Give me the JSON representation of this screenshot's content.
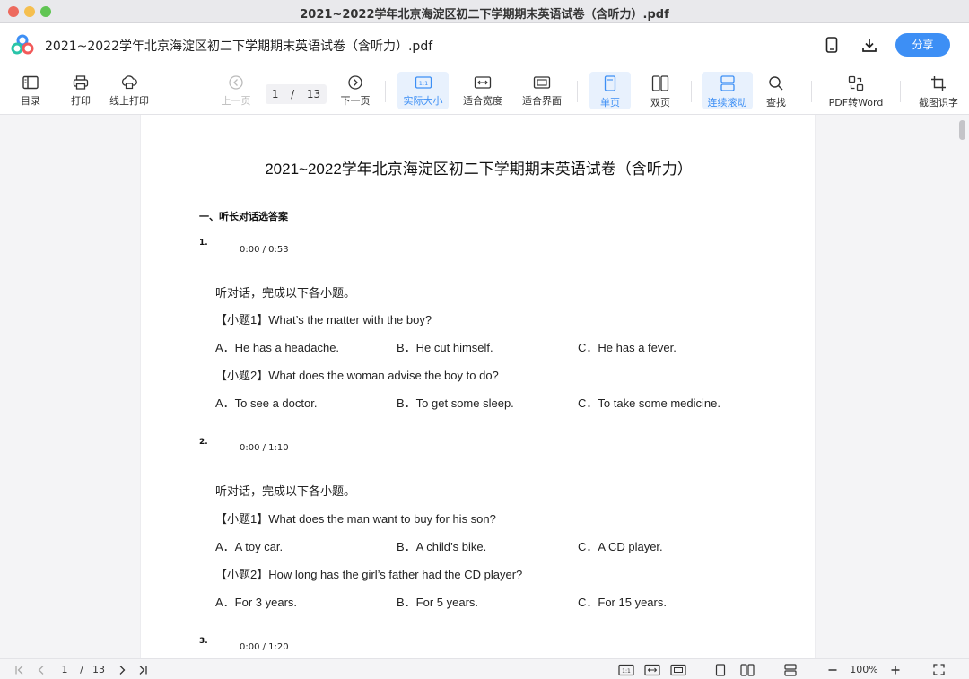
{
  "window": {
    "title": "2021~2022学年北京海淀区初二下学期期末英语试卷（含听力）.pdf"
  },
  "header": {
    "doc_title": "2021~2022学年北京海淀区初二下学期期末英语试卷（含听力）.pdf",
    "share_label": "分享",
    "icons": [
      "phone-icon",
      "download-icon"
    ]
  },
  "toolbar": {
    "toc": "目录",
    "print": "打印",
    "online_print": "线上打印",
    "prev": "上一页",
    "page_current": "1",
    "page_sep": "/",
    "page_total": "13",
    "next": "下一页",
    "actual_size": "实际大小",
    "fit_width": "适合宽度",
    "fit_page": "适合界面",
    "single": "单页",
    "double": "双页",
    "continuous": "连续滚动",
    "find": "查找",
    "pdf_to_word": "PDF转Word",
    "ocr": "截图识字",
    "actual_size_icon_text": "1:1"
  },
  "document": {
    "title": "2021~2022学年北京海淀区初二下学期期末英语试卷（含听力）",
    "section": "一、听长对话选答案",
    "questions": [
      {
        "num": "1.",
        "audio": "0:00 / 0:53",
        "intro": "听对话，完成以下各小题。",
        "sub": [
          {
            "q": "【小题1】What’s the matter with the boy?",
            "a": "A．He has a headache.",
            "b": "B．He cut himself.",
            "c": "C．He has a fever."
          },
          {
            "q": "【小题2】What does the woman advise the boy to do?",
            "a": "A．To see a doctor.",
            "b": "B．To get some sleep.",
            "c": "C．To take some medicine."
          }
        ]
      },
      {
        "num": "2.",
        "audio": "0:00 / 1:10",
        "intro": "听对话，完成以下各小题。",
        "sub": [
          {
            "q": "【小题1】What does the man want to buy for his son?",
            "a": "A．A toy car.",
            "b": "B．A child’s bike.",
            "c": "C．A CD player."
          },
          {
            "q": "【小题2】How long has the girl’s father had the CD player?",
            "a": "A．For 3 years.",
            "b": "B．For 5 years.",
            "c": "C．For 15 years."
          }
        ]
      },
      {
        "num": "3.",
        "audio": "0:00 / 1:20"
      }
    ]
  },
  "statusbar": {
    "page_current": "1",
    "page_sep": "/",
    "page_total": "13",
    "zoom": "100%",
    "actual_size_icon_text": "1:1"
  }
}
